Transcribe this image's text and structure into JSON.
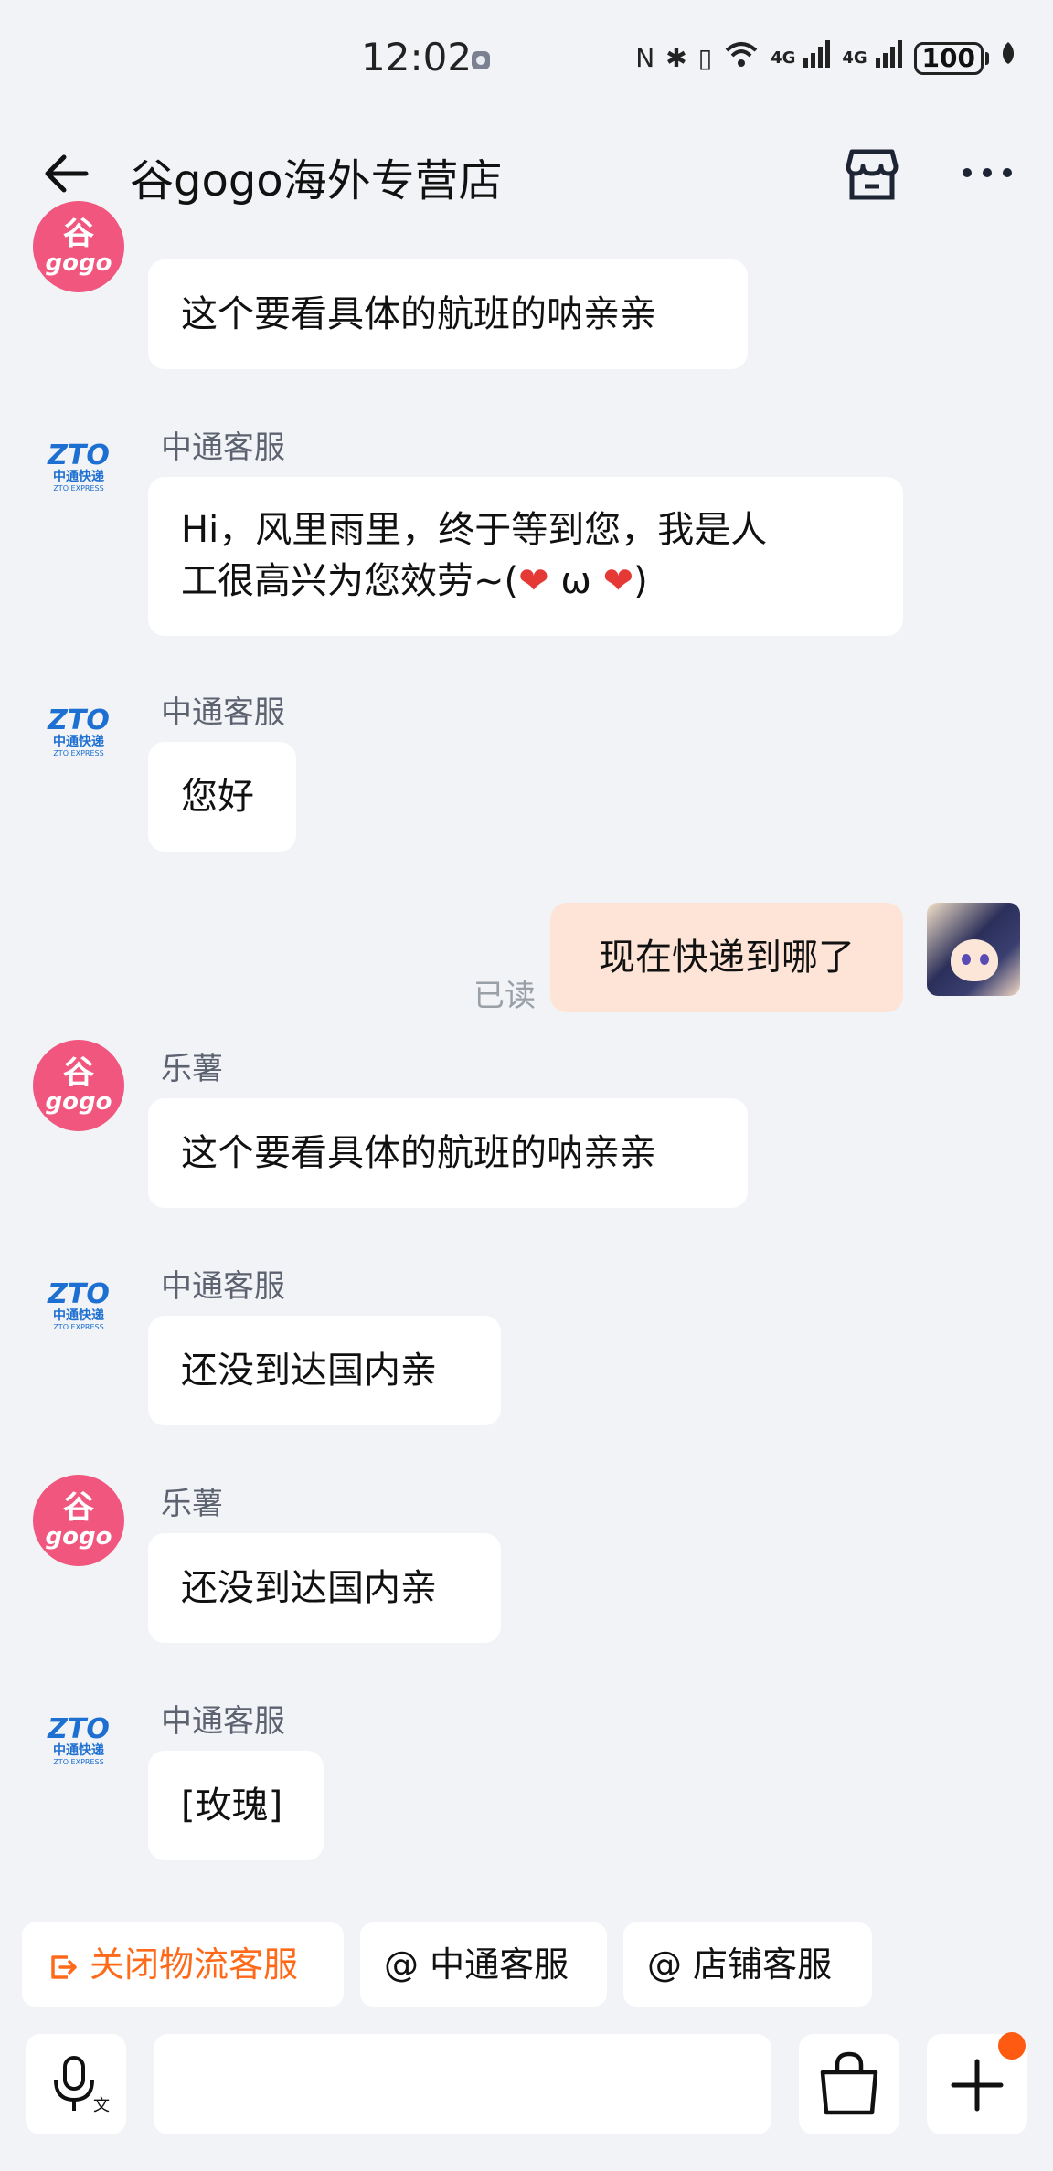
{
  "status_bar": {
    "time": "12:02",
    "nfc": "N",
    "bluetooth": "✱",
    "vibrate": "▯",
    "wifi": "⁶",
    "signal1": "4G",
    "signal2": "4G",
    "battery": "100"
  },
  "header": {
    "title": "谷gogo海外专营店"
  },
  "messages": [
    {
      "sender": "乐薯",
      "text": "这个要看具体的航班的呐亲亲",
      "avatar": "gogo"
    },
    {
      "sender": "中通客服",
      "text_part1": "Hi，风里雨里，终于等到您，我是人",
      "text_part2a": "工很高兴为您效劳~(",
      "heart": "❤",
      "omega": " ω ",
      "text_part2b": ")",
      "avatar": "zto"
    },
    {
      "sender": "中通客服",
      "text": "您好",
      "avatar": "zto"
    },
    {
      "text": "现在快递到哪了",
      "read_status": "已读",
      "outgoing": true
    },
    {
      "sender": "乐薯",
      "text": "这个要看具体的航班的呐亲亲",
      "avatar": "gogo"
    },
    {
      "sender": "中通客服",
      "text": "还没到达国内亲",
      "avatar": "zto"
    },
    {
      "sender": "乐薯",
      "text": "还没到达国内亲",
      "avatar": "gogo"
    },
    {
      "sender": "中通客服",
      "text": "[玫瑰]",
      "avatar": "zto"
    }
  ],
  "avatars": {
    "gogo_line1": "谷",
    "gogo_line2": "gogo",
    "zto_line1": "ZTO",
    "zto_line2": "中通快递",
    "zto_line3": "ZTO EXPRESS"
  },
  "quick_actions": [
    {
      "label": "关闭物流客服",
      "color": "#ff6a1a"
    },
    {
      "label": "@ 中通客服"
    },
    {
      "label": "@ 店铺客服"
    }
  ],
  "colors": {
    "background": "#f1f3f6",
    "outgoing_bubble": "#fde4d6",
    "accent_orange": "#ff6a1a",
    "gogo_pink": "#f0567e",
    "zto_blue": "#1d6fd1"
  },
  "icons": {
    "back": "arrow-left-icon",
    "store": "store-icon",
    "more": "more-dots-icon",
    "voice": "voice-input-icon",
    "emoji": "emoji-icon",
    "bag": "shopping-bag-icon",
    "plus": "plus-icon"
  }
}
